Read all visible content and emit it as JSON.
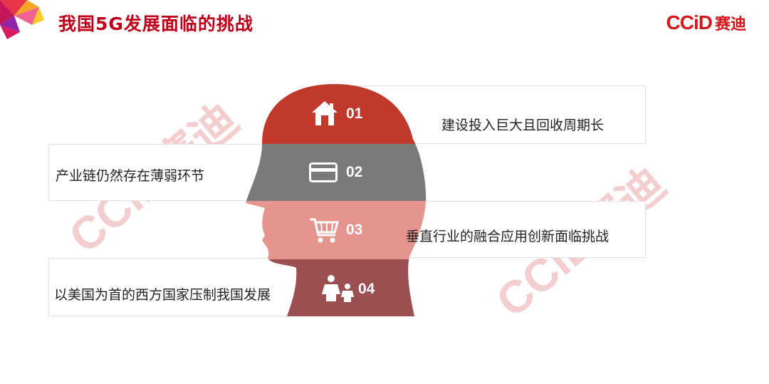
{
  "title": "我国5G发展面临的挑战",
  "logo": {
    "brand": "CCiD",
    "cn": "赛迪"
  },
  "watermark": "CCiD赛迪",
  "challenges": [
    {
      "number": "01",
      "icon": "house-icon",
      "text": "建设投入巨大且回收周期长",
      "color": "#c0392b"
    },
    {
      "number": "02",
      "icon": "card-icon",
      "text": "产业链仍然存在薄弱环节",
      "color": "#7a7a7a"
    },
    {
      "number": "03",
      "icon": "cart-icon",
      "text": "垂直行业的融合应用创新面临挑战",
      "color": "#e6948e"
    },
    {
      "number": "04",
      "icon": "family-icon",
      "text": "以美国为首的西方国家压制我国发展",
      "color": "#9b4f50"
    }
  ]
}
